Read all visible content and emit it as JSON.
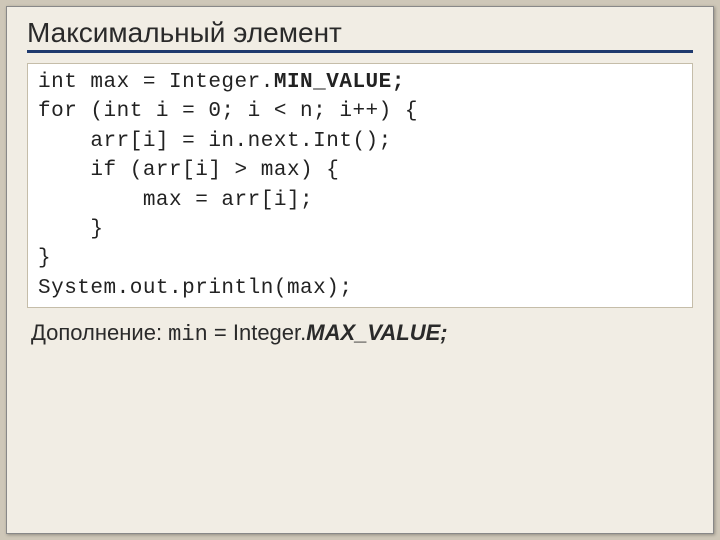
{
  "title": "Максимальный элемент",
  "code": {
    "l1a": "int max = Integer.",
    "l1b": "MIN_VALUE;",
    "l2": "for (int i = 0; i < n; i++) {",
    "l3": "    arr[i] = in.next.Int();",
    "l4": "    if (arr[i] > max) {",
    "l5": "        max = arr[i];",
    "l6": "    }",
    "l7": "}",
    "l8": "System.out.println(max);"
  },
  "note": {
    "label": "Дополнение: ",
    "code_mono": "min",
    "code_rest": " = Integer.",
    "code_ital": "MAX_VALUE;"
  }
}
